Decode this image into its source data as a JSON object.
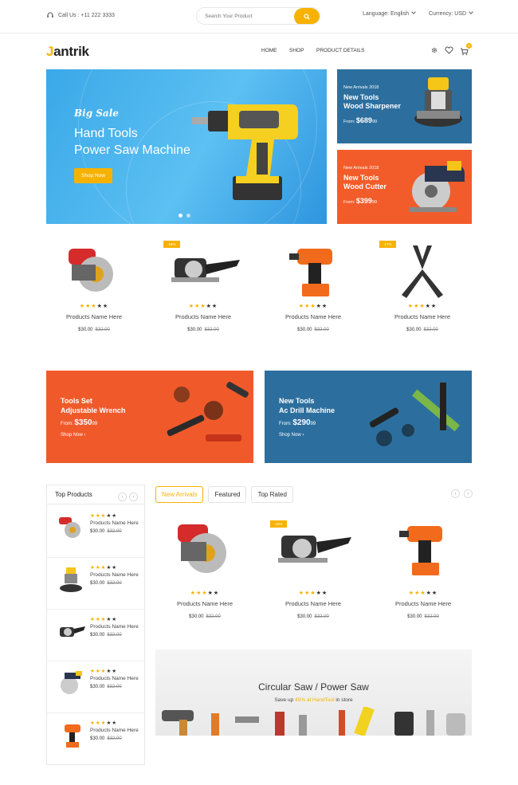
{
  "topbar": {
    "call": "Call Us : +11 222 3333",
    "search_placeholder": "Search Your Product",
    "language": "Language: English",
    "currency": "Currency: USD"
  },
  "header": {
    "logo_j": "J",
    "logo_rest": "antrik",
    "nav": [
      "HOME",
      "SHOP",
      "PRODUCT DETAILS"
    ],
    "cart_count": "0"
  },
  "hero": {
    "tagline": "Big Sale",
    "title_line1": "Hand Tools",
    "title_line2": "Power Saw Machine",
    "button": "Shop Now"
  },
  "side_banners": [
    {
      "small": "New Arrivals 2018",
      "title1": "New Tools",
      "title2": "Wood Sharpener",
      "from": "From:",
      "price": "$689",
      "cents": "99"
    },
    {
      "small": "New Arrivals 2018",
      "title1": "New Tools",
      "title2": "Wood Cutter",
      "from": "From:",
      "price": "$399",
      "cents": "99"
    }
  ],
  "products": [
    {
      "name": "Products Name Here",
      "price": "$30.00",
      "old": "$32.00",
      "rating": 3,
      "badge": ""
    },
    {
      "name": "Products Name Here",
      "price": "$30.00",
      "old": "$32.00",
      "rating": 3,
      "badge": "-16%"
    },
    {
      "name": "Products Name Here",
      "price": "$30.00",
      "old": "$32.00",
      "rating": 3,
      "badge": ""
    },
    {
      "name": "Products Name Here",
      "price": "$30.00",
      "old": "$32.00",
      "rating": 3,
      "badge": "-17%"
    }
  ],
  "promo": [
    {
      "title1": "Tools Set",
      "title2": "Adjustable Wrench",
      "from": "From:",
      "price": "$350",
      "cents": "99",
      "link": "Shop Now"
    },
    {
      "title1": "New Tools",
      "title2": "Ac Drill Machine",
      "from": "From:",
      "price": "$290",
      "cents": "99",
      "link": "Shop Now"
    }
  ],
  "top_products": {
    "title": "Top Products",
    "items": [
      {
        "name": "Products Name Here",
        "price": "$30.00",
        "old": "$32.00",
        "rating": 3
      },
      {
        "name": "Products Name Here",
        "price": "$30.00",
        "old": "$32.00",
        "rating": 3
      },
      {
        "name": "Products Name Here",
        "price": "$30.00",
        "old": "$32.00",
        "rating": 3
      },
      {
        "name": "Products Name Here",
        "price": "$30.00",
        "old": "$32.00",
        "rating": 3
      },
      {
        "name": "Products Name Here",
        "price": "$30.00",
        "old": "$32.00",
        "rating": 3
      }
    ]
  },
  "tabs": [
    "New Arrivals",
    "Featured",
    "Top Rated"
  ],
  "tab_products": [
    {
      "name": "Products Name Here",
      "price": "$30.00",
      "old": "$32.00",
      "rating": 3,
      "badge": ""
    },
    {
      "name": "Products Name Here",
      "price": "$30.00",
      "old": "$32.00",
      "rating": 3,
      "badge": "-16%"
    },
    {
      "name": "Products Name Here",
      "price": "$30.00",
      "old": "$32.00",
      "rating": 3,
      "badge": ""
    }
  ],
  "bottom_banner": {
    "title": "Circular Saw / Power Saw",
    "sub_before": "Save up ",
    "sub_highlight": "45% at HandTool",
    "sub_after": " in store"
  },
  "colors": {
    "accent": "#f7b200",
    "blue": "#2c6f9e",
    "orange": "#f25c2a",
    "hero": "#3aa8e8"
  }
}
